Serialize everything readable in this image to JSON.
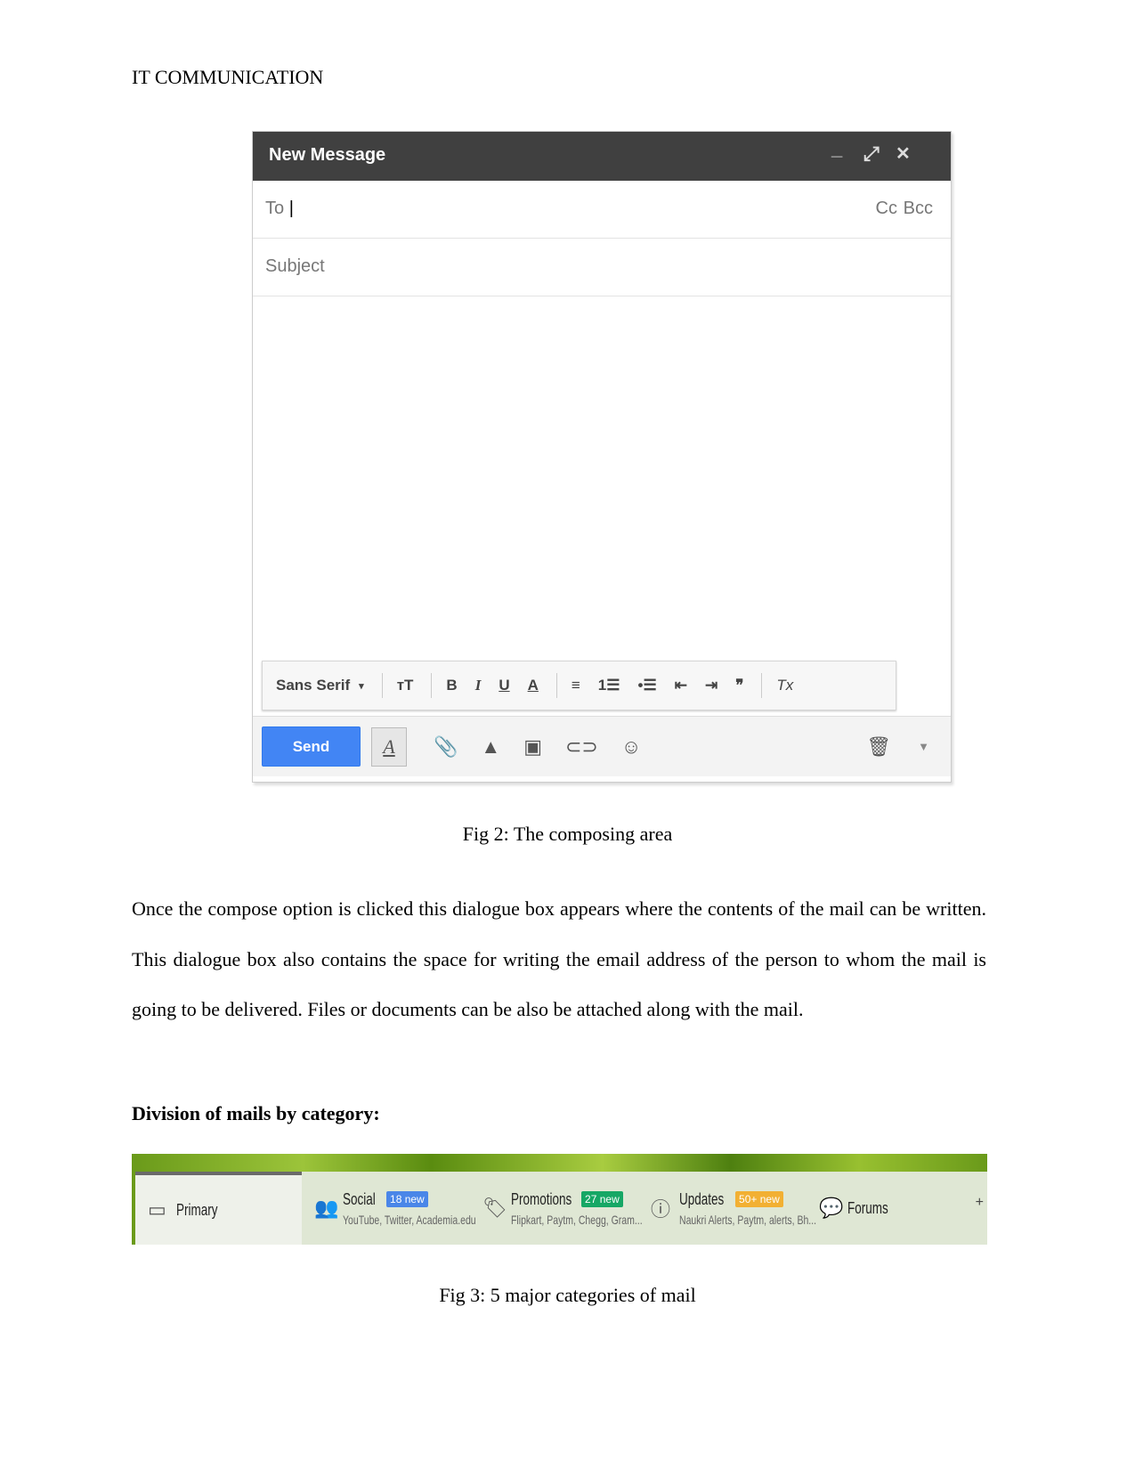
{
  "header": {
    "running_title": "IT COMMUNICATION"
  },
  "compose": {
    "title": "New Message",
    "controls": {
      "minimize": "_",
      "expand": "⤢",
      "close": "✕"
    },
    "to_label": "To",
    "cc": "Cc",
    "bcc": "Bcc",
    "subject_placeholder": "Subject",
    "format": {
      "font": "Sans Serif",
      "size": "тT",
      "bold": "B",
      "italic": "I",
      "underline": "U",
      "color": "A",
      "align": "≡",
      "numbered": "1☰",
      "bulleted": "•☰",
      "outdent": "⇤",
      "indent": "⇥",
      "quote": "❞",
      "clear": "Tx"
    },
    "send_label": "Send",
    "format_toggle": "A",
    "icons": [
      "paperclip-icon",
      "drive-icon",
      "photo-icon",
      "link-icon",
      "emoji-icon",
      "trash-icon",
      "more-options-icon"
    ]
  },
  "fig2_caption": "Fig 2: The composing area",
  "paragraph": "Once the compose option is clicked this dialogue box appears where the contents of the mail can be written. This dialogue box also contains the space for writing the email address of the person to whom the mail is going to be delivered. Files or documents can be also be attached along with the mail.",
  "heading": "Division of mails by category:",
  "categories": [
    {
      "name": "Primary"
    },
    {
      "name": "Social",
      "badge": "18 new",
      "badge_color": "#4a86e8",
      "sub": "YouTube, Twitter, Academia.edu"
    },
    {
      "name": "Promotions",
      "badge": "27 new",
      "badge_color": "#16a765",
      "sub": "Flipkart, Paytm, Chegg, Gram..."
    },
    {
      "name": "Updates",
      "badge": "50+ new",
      "badge_color": "#f2b033",
      "sub": "Naukri Alerts, Paytm, alerts, Bh..."
    },
    {
      "name": "Forums"
    }
  ],
  "add_tab": "+",
  "fig3_caption": "Fig 3: 5 major categories of mail"
}
